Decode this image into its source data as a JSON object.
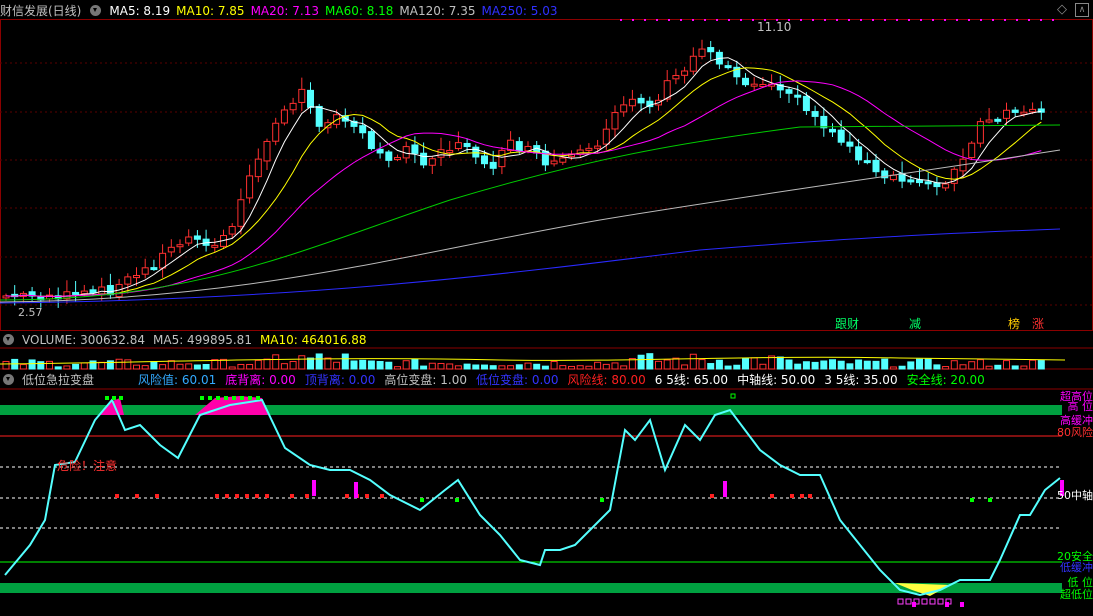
{
  "main": {
    "title": "财信发展(日线)",
    "ma": [
      {
        "label": "MA5: 8.19",
        "color": "#ffffff"
      },
      {
        "label": "MA10: 7.85",
        "color": "#ffff00"
      },
      {
        "label": "MA20: 7.13",
        "color": "#ff00ff"
      },
      {
        "label": "MA60: 8.18",
        "color": "#00ff00"
      },
      {
        "label": "MA120: 7.35",
        "color": "#c0c0c0"
      },
      {
        "label": "MA250: 5.03",
        "color": "#3030ff"
      }
    ],
    "high_label": "11.10",
    "low_label": "2.57",
    "signals": [
      {
        "text": "跟财",
        "color": "#00ff66"
      },
      {
        "text": "减",
        "color": "#00ff66"
      },
      {
        "text": "榜",
        "color": "#ffcc00"
      },
      {
        "text": "涨",
        "color": "#ff3030"
      }
    ]
  },
  "volume": {
    "label": "VOLUME: 300632.84",
    "ma5": "MA5: 499895.81",
    "ma10": "MA10: 464016.88"
  },
  "indicator": {
    "title": "低位急拉变盘",
    "items": [
      {
        "label": "风险值: 60.01",
        "color": "#33aaff"
      },
      {
        "label": "底背离: 0.00",
        "color": "#ff00ff"
      },
      {
        "label": "顶背离: 0.00",
        "color": "#3333ff"
      },
      {
        "label": "高位变盘: 1.00",
        "color": "#c0c0c0"
      },
      {
        "label": "低位变盘: 0.00",
        "color": "#3333ff"
      },
      {
        "label": "风险线: 80.00",
        "color": "#ff2020"
      },
      {
        "label": "6 5线: 65.00",
        "color": "#ffffff"
      },
      {
        "label": "中轴线: 50.00",
        "color": "#ffffff"
      },
      {
        "label": "3 5线: 35.00",
        "color": "#ffffff"
      },
      {
        "label": "安全线: 20.00",
        "color": "#00ff00"
      }
    ],
    "warning": "危险！注意",
    "right_labels": [
      {
        "text": "超高位",
        "color": "#ff00ff"
      },
      {
        "text": "高 位",
        "color": "#ff00ff"
      },
      {
        "text": "高缓冲",
        "color": "#ff00ff"
      },
      {
        "text": "80风险",
        "color": "#ff3030"
      },
      {
        "text": "50中轴",
        "color": "#ffffff"
      },
      {
        "text": "20安全",
        "color": "#00ff00"
      },
      {
        "text": "低缓冲",
        "color": "#3333ff"
      },
      {
        "text": "低 位",
        "color": "#00ff00"
      },
      {
        "text": "超低位",
        "color": "#00ff00"
      }
    ]
  }
}
